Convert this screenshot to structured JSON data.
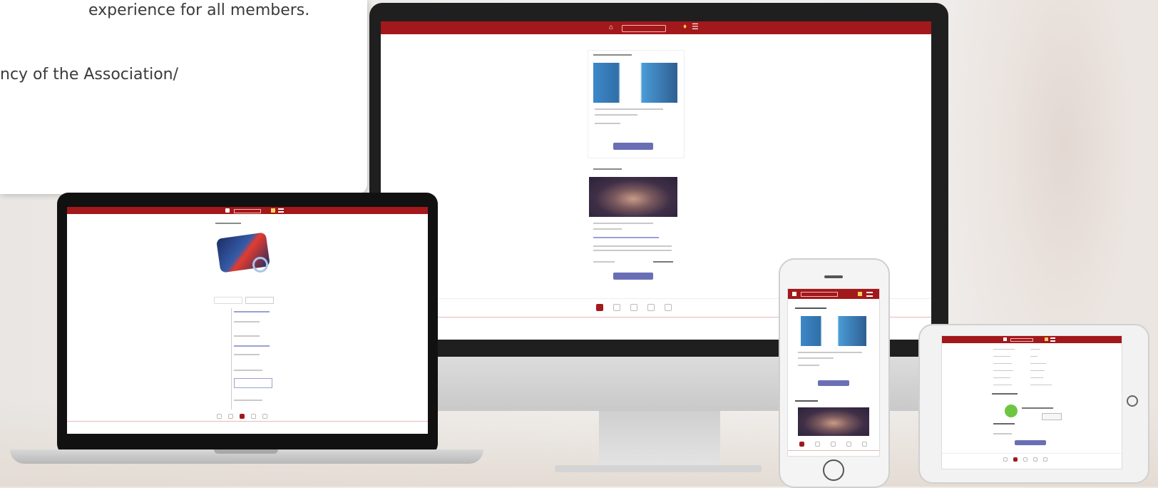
{
  "card": {
    "line1": "experience for all members.",
    "line2": "ncy of the Association/"
  },
  "colors": {
    "brand_red": "#a3181b",
    "button_purple": "#6a6fb5",
    "device_black": "#1f1f1f"
  },
  "icons": [
    "home-icon",
    "menu-icon",
    "bell-icon"
  ]
}
